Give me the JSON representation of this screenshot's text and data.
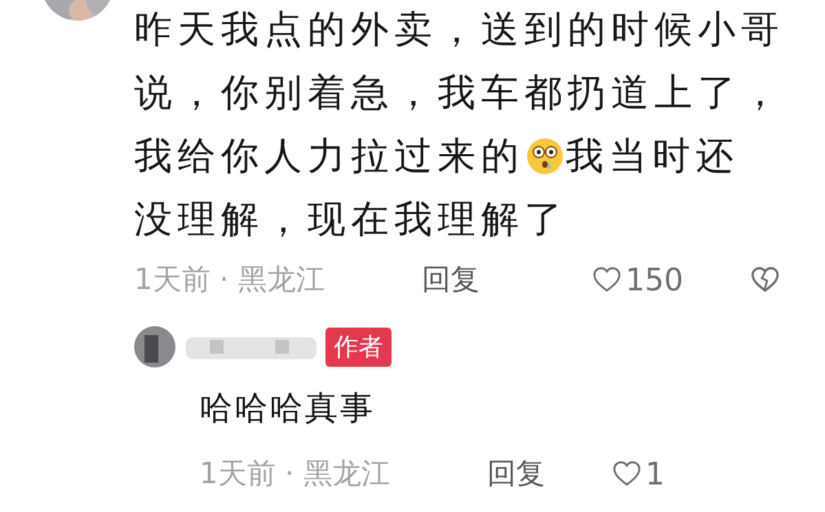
{
  "comment": {
    "avatar": {
      "kind": "picture"
    },
    "lines": [
      [
        {
          "kind": "text",
          "text": "昨天我点的外卖，送到的时候小哥"
        }
      ],
      [
        {
          "kind": "text",
          "text": "说，你别着急，我车都扔道上了，"
        }
      ],
      [
        {
          "kind": "text",
          "text": "我给你人力拉过来的"
        },
        {
          "kind": "emoji"
        },
        {
          "kind": "text",
          "text": "我当时还"
        }
      ],
      [
        {
          "kind": "text",
          "text": "没理解，现在我理解了"
        }
      ]
    ],
    "time": "1天前 · 黑龙江",
    "reply_label": "回复",
    "likes": "150",
    "liked": false
  },
  "reply": {
    "badge": "作者",
    "text": "哈哈哈真事",
    "time": "1天前 · 黑龙江",
    "reply_label": "回复",
    "likes": "1",
    "liked": false
  }
}
